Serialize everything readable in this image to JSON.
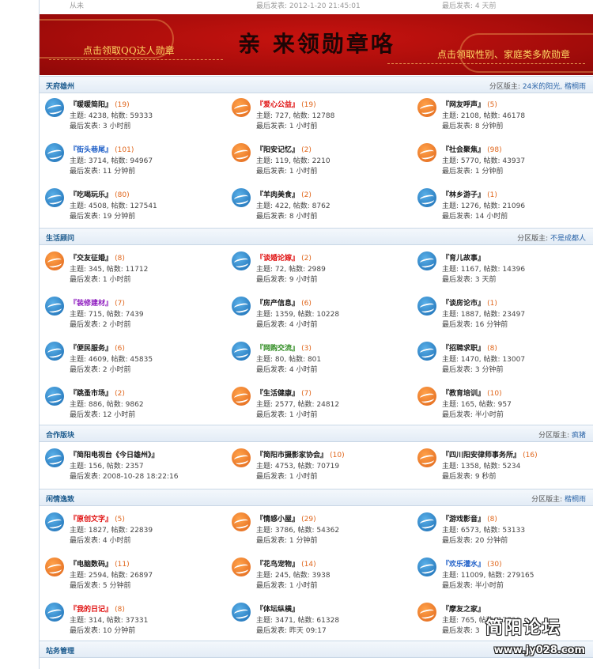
{
  "top_row": {
    "left_text": "从未",
    "mid_text": "最后发表: 2012-1-20 21:45:01",
    "right_text": "最后发表: 4 天前"
  },
  "banner": {
    "title": "亲 来领勋章咯",
    "left_link": "点击领取QQ达人勋章",
    "right_link": "点击领取性别、家庭类多款勋章",
    "colors": {
      "background": "#b50f0c",
      "accent": "#ffd964"
    }
  },
  "categories": [
    {
      "title": "天府雄州",
      "mods_label": "分区版主:",
      "mods": "24米的阳光, 楷桐雨",
      "forums": [
        {
          "name": "『暖暖简阳』",
          "today": "(19)",
          "style": "",
          "icon": "blue",
          "stats": "主题: 4238, 帖数: 59333",
          "last": "最后发表: 3 小时前"
        },
        {
          "name": "『爱心公益』",
          "today": "(19)",
          "style": "red",
          "icon": "orange",
          "stats": "主题: 727, 帖数: 12788",
          "last": "最后发表: 1 小时前"
        },
        {
          "name": "『网友呼声』",
          "today": "(5)",
          "style": "",
          "icon": "orange",
          "stats": "主题: 2108, 帖数: 46178",
          "last": "最后发表: 8 分钟前"
        },
        {
          "name": "『街头巷尾』",
          "today": "(101)",
          "style": "blue",
          "icon": "blue",
          "stats": "主题: 3714, 帖数: 94967",
          "last": "最后发表: 11 分钟前"
        },
        {
          "name": "『阳安记忆』",
          "today": "(2)",
          "style": "",
          "icon": "orange",
          "stats": "主题: 119, 帖数: 2210",
          "last": "最后发表: 1 小时前"
        },
        {
          "name": "『社会聚焦』",
          "today": "(98)",
          "style": "",
          "icon": "orange",
          "stats": "主题: 5770, 帖数: 43937",
          "last": "最后发表: 1 分钟前"
        },
        {
          "name": "『吃喝玩乐』",
          "today": "(80)",
          "style": "",
          "icon": "blue",
          "stats": "主题: 4508, 帖数: 127541",
          "last": "最后发表: 19 分钟前"
        },
        {
          "name": "『羊肉美食』",
          "today": "(2)",
          "style": "",
          "icon": "blue",
          "stats": "主题: 422, 帖数: 8762",
          "last": "最后发表: 8 小时前"
        },
        {
          "name": "『林乡游子』",
          "today": "(1)",
          "style": "",
          "icon": "blue",
          "stats": "主题: 1276, 帖数: 21096",
          "last": "最后发表: 14 小时前"
        }
      ]
    },
    {
      "title": "生活顾问",
      "mods_label": "分区版主:",
      "mods": "不是成都人",
      "forums": [
        {
          "name": "『交友征婚』",
          "today": "(8)",
          "style": "",
          "icon": "orange",
          "stats": "主题: 345, 帖数: 11712",
          "last": "最后发表: 1 小时前"
        },
        {
          "name": "『谈婚论嫁』",
          "today": "(2)",
          "style": "red",
          "icon": "blue",
          "stats": "主题: 72, 帖数: 2989",
          "last": "最后发表: 9 小时前"
        },
        {
          "name": "『育儿故事』",
          "today": "",
          "style": "",
          "icon": "blue",
          "stats": "主题: 1167, 帖数: 14396",
          "last": "最后发表: 3 天前"
        },
        {
          "name": "『装修建材』",
          "today": "(7)",
          "style": "purple",
          "icon": "blue",
          "stats": "主题: 715, 帖数: 7439",
          "last": "最后发表: 2 小时前"
        },
        {
          "name": "『房产信息』",
          "today": "(6)",
          "style": "",
          "icon": "blue",
          "stats": "主题: 1359, 帖数: 10228",
          "last": "最后发表: 4 小时前"
        },
        {
          "name": "『谈房论市』",
          "today": "(1)",
          "style": "",
          "icon": "blue",
          "stats": "主题: 1887, 帖数: 23497",
          "last": "最后发表: 16 分钟前"
        },
        {
          "name": "『便民服务』",
          "today": "(6)",
          "style": "",
          "icon": "blue",
          "stats": "主题: 4609, 帖数: 45835",
          "last": "最后发表: 2 小时前"
        },
        {
          "name": "『网购交流』",
          "today": "(3)",
          "style": "green",
          "icon": "blue",
          "stats": "主题: 80, 帖数: 801",
          "last": "最后发表: 4 小时前"
        },
        {
          "name": "『招聘求职』",
          "today": "(8)",
          "style": "",
          "icon": "blue",
          "stats": "主题: 1470, 帖数: 13007",
          "last": "最后发表: 3 分钟前"
        },
        {
          "name": "『跳蚤市场』",
          "today": "(2)",
          "style": "",
          "icon": "blue",
          "stats": "主题: 886, 帖数: 9862",
          "last": "最后发表: 12 小时前"
        },
        {
          "name": "『生活健康』",
          "today": "(7)",
          "style": "",
          "icon": "orange",
          "stats": "主题: 2577, 帖数: 24812",
          "last": "最后发表: 1 小时前"
        },
        {
          "name": "『教育培训』",
          "today": "(10)",
          "style": "",
          "icon": "orange",
          "stats": "主题: 165, 帖数: 957",
          "last": "最后发表: 半小时前"
        }
      ]
    },
    {
      "title": "合作版块",
      "mods_label": "分区版主:",
      "mods": "疯猪",
      "forums": [
        {
          "name": "『简阳电视台《今日雄州》』",
          "today": "",
          "style": "",
          "icon": "blue",
          "stats": "主题: 156, 帖数: 2357",
          "last": "最后发表: 2008-10-28 18:22:16"
        },
        {
          "name": "『简阳市摄影家协会』",
          "today": "(10)",
          "style": "",
          "icon": "orange",
          "stats": "主题: 4753, 帖数: 70719",
          "last": "最后发表: 1 小时前"
        },
        {
          "name": "『四川阳安律师事务所』",
          "today": "(16)",
          "style": "",
          "icon": "orange",
          "stats": "主题: 1358, 帖数: 5234",
          "last": "最后发表: 9 秒前"
        }
      ]
    },
    {
      "title": "闲情逸致",
      "mods_label": "分区版主:",
      "mods": "楷桐雨",
      "forums": [
        {
          "name": "『原创文字』",
          "today": "(5)",
          "style": "red",
          "icon": "blue",
          "stats": "主题: 1827, 帖数: 22839",
          "last": "最后发表: 4 小时前"
        },
        {
          "name": "『情感小屋』",
          "today": "(29)",
          "style": "",
          "icon": "orange",
          "stats": "主题: 3786, 帖数: 54362",
          "last": "最后发表: 1 分钟前"
        },
        {
          "name": "『游戏影音』",
          "today": "(8)",
          "style": "",
          "icon": "blue",
          "stats": "主题: 6573, 帖数: 53133",
          "last": "最后发表: 20 分钟前"
        },
        {
          "name": "『电脑数码』",
          "today": "(11)",
          "style": "",
          "icon": "orange",
          "stats": "主题: 2594, 帖数: 26897",
          "last": "最后发表: 5 分钟前"
        },
        {
          "name": "『花鸟宠物』",
          "today": "(14)",
          "style": "",
          "icon": "orange",
          "stats": "主题: 245, 帖数: 3938",
          "last": "最后发表: 1 小时前"
        },
        {
          "name": "『欢乐灌水』",
          "today": "(30)",
          "style": "blue",
          "icon": "blue",
          "stats": "主题: 11009, 帖数: 279165",
          "last": "最后发表: 半小时前"
        },
        {
          "name": "『我的日记』",
          "today": "(8)",
          "style": "red",
          "icon": "blue",
          "stats": "主题: 314, 帖数: 37331",
          "last": "最后发表: 10 分钟前"
        },
        {
          "name": "『体坛纵横』",
          "today": "",
          "style": "",
          "icon": "blue",
          "stats": "主题: 3471, 帖数: 61328",
          "last": "最后发表: 昨天 09:17"
        },
        {
          "name": "『摩友之家』",
          "today": "",
          "style": "",
          "icon": "orange",
          "stats": "主题: 765, 帖数: 17739",
          "last": "最后发表: 3"
        }
      ]
    },
    {
      "title": "站务管理",
      "mods_label": "",
      "mods": "",
      "forums": []
    }
  ],
  "watermark": {
    "logo_text": "简阳论坛",
    "url_text": "www.jy028.com"
  }
}
